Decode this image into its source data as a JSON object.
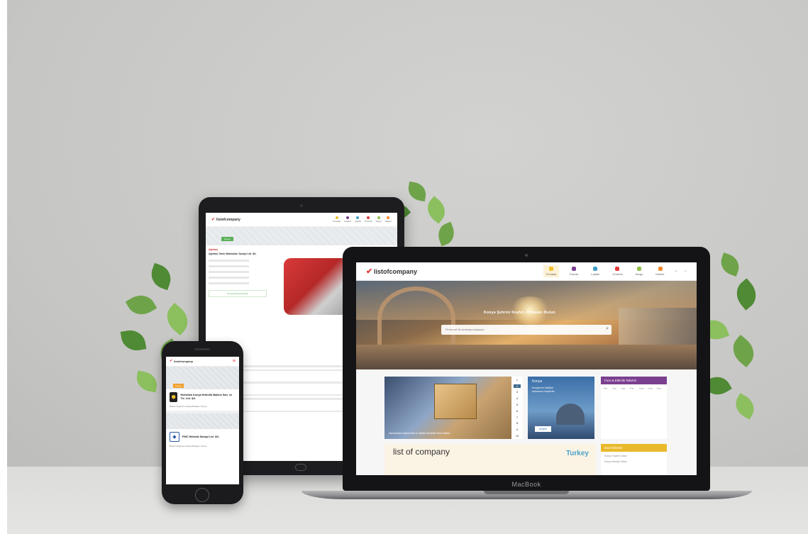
{
  "laptop": {
    "brand_label": "MacBook",
    "site": {
      "logo_text": "listofcompany",
      "nav": [
        "Firmalar",
        "Fuarlar",
        "Lojistik",
        "Gümrük",
        "Kargo",
        "Ülkeler"
      ],
      "hero_headline": "Konya Şehrini Keşfet, Firmaları Bulun",
      "search_placeholder": "Firma adı ile aramaya başlayın",
      "slider_caption": "Uluslararası taşımacılık ve lojistik hizmetleri firma listesi",
      "pager": [
        "1",
        "2",
        "3",
        "4",
        "5",
        "6",
        "7",
        "8",
        "9",
        "10"
      ],
      "city_card": {
        "title": "Konya",
        "text": "Konya'nın kültürel dokusunu keşfedin",
        "button": "Keşfet"
      },
      "calendar_title": "Fuar & Etkinlik Takvimi",
      "calendar_days": [
        "Pzt",
        "Sal",
        "Çar",
        "Per",
        "Cum",
        "Cmt",
        "Paz"
      ],
      "events_title": "Son Eklenler",
      "events_rows": [
        "Konya Ticaret Odası",
        "Konya Sanayi Odası"
      ],
      "banner_text": "list of company",
      "banner_tag": "Turkey"
    }
  },
  "tablet": {
    "site": {
      "logo_text": "listofcompany",
      "nav": [
        "Firmalar",
        "Fuarlar",
        "Lojistik",
        "Gümrük",
        "Kargo",
        "Ülkeler"
      ],
      "map_tag": "Konya",
      "company_logo": "Ağırbaş",
      "company_name": "Ağırbaş Tarım Makinaları Sanayi Ltd. Şti.",
      "contact_button": "Firmaya Mesaj Gönder",
      "section_headings": [
        "Firma Faaliyetleri",
        "Ürünler",
        "Benzer Firmalar",
        "Firma Hakkında"
      ]
    }
  },
  "phone": {
    "site": {
      "logo_text": "listofcompany",
      "map_tag": "Konya",
      "card1": {
        "name": "Hidroltan Konya Hidrolik Makine San. ve Tic. Ltd. Şti.",
        "info": "Büsan Organize Sanayi Bölgesi, Konya"
      },
      "card2": {
        "name": "PMC Hidrolik Sanayi Ltd. Şti.",
        "info": "Büsan Organize Sanayi Bölgesi, Konya"
      }
    }
  }
}
